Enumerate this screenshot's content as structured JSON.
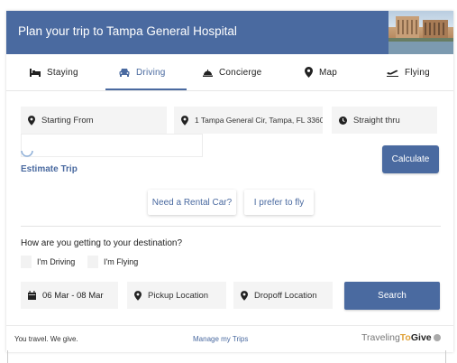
{
  "header": {
    "title": "Plan your trip to Tampa General Hospital"
  },
  "tabs": [
    {
      "label": "Staying",
      "icon": "bed-icon"
    },
    {
      "label": "Driving",
      "icon": "car-icon",
      "active": true
    },
    {
      "label": "Concierge",
      "icon": "concierge-bell-icon"
    },
    {
      "label": "Map",
      "icon": "map-pin-icon"
    },
    {
      "label": "Flying",
      "icon": "plane-icon"
    }
  ],
  "trip": {
    "start_placeholder": "Starting From",
    "destination": "1 Tampa General Cir, Tampa, FL 3360",
    "route_option": "Straight thru",
    "calculate": "Calculate",
    "estimate_label": "Estimate Trip"
  },
  "options": {
    "rental": "Need a Rental Car?",
    "fly": "I prefer to fly"
  },
  "transport": {
    "question": "How are you getting to your destination?",
    "driving": "I'm Driving",
    "flying": "I'm Flying"
  },
  "rental_search": {
    "dates": "06 Mar - 08 Mar",
    "pickup": "Pickup Location",
    "dropoff": "Dropoff Location",
    "search": "Search"
  },
  "footer": {
    "tagline": "You travel. We give.",
    "manage": "Manage my Trips",
    "brand_pre": "Traveling",
    "brand_to": "To",
    "brand_give": "Give"
  },
  "colors": {
    "accent": "#4a6aa0",
    "brand_orange": "#e0a23a"
  }
}
